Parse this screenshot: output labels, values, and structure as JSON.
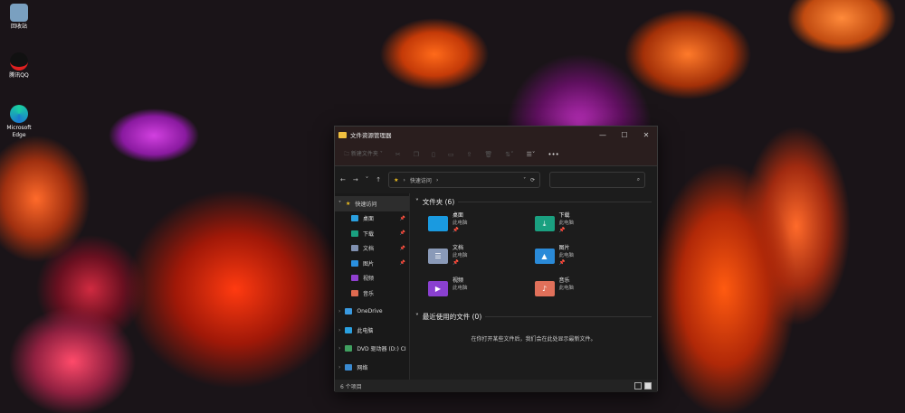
{
  "desktop": [
    {
      "label": "回收站",
      "color": "#7aa0c0"
    },
    {
      "label": "腾讯QQ",
      "color": "#111"
    },
    {
      "label": "Microsoft Edge",
      "color": "#1a9ad0"
    }
  ],
  "window": {
    "title": "文件资源管理器",
    "new_folder": "新建文件夹",
    "more": "•••",
    "address": {
      "path": "快速访问",
      "sep": "›"
    },
    "search_placeholder": ""
  },
  "sidebar": {
    "quick": "快速访问",
    "items": [
      {
        "label": "桌面",
        "color": "#2aa0e0",
        "pinned": true
      },
      {
        "label": "下载",
        "color": "#1aa080",
        "pinned": true
      },
      {
        "label": "文档",
        "color": "#8090b0",
        "pinned": true
      },
      {
        "label": "图片",
        "color": "#2a90e0",
        "pinned": true
      },
      {
        "label": "视频",
        "color": "#9040d0",
        "pinned": false
      },
      {
        "label": "音乐",
        "color": "#e06a50",
        "pinned": false
      }
    ],
    "roots": [
      "OneDrive",
      "此电脑",
      "DVD 驱动器 (D:) CI",
      "网络"
    ]
  },
  "folders": {
    "header": "文件夹 (6)",
    "items": [
      {
        "name": "桌面",
        "loc": "此电脑",
        "color": "#1a9ae0",
        "glyph": "",
        "pin": true
      },
      {
        "name": "下载",
        "loc": "此电脑",
        "color": "#1aa080",
        "glyph": "⤓",
        "pin": true
      },
      {
        "name": "文档",
        "loc": "此电脑",
        "color": "#8a9ab8",
        "glyph": "☰",
        "pin": true
      },
      {
        "name": "图片",
        "loc": "此电脑",
        "color": "#2a8ad8",
        "glyph": "▲",
        "pin": true
      },
      {
        "name": "视频",
        "loc": "此电脑",
        "color": "#8a40d0",
        "glyph": "▶",
        "pin": false
      },
      {
        "name": "音乐",
        "loc": "此电脑",
        "color": "#e0705a",
        "glyph": "♪",
        "pin": false
      }
    ]
  },
  "recent": {
    "header": "最近使用的文件 (0)",
    "empty": "在你打开某些文件后，我们会在此处显示最新文件。"
  },
  "status": {
    "count": "6 个项目"
  }
}
